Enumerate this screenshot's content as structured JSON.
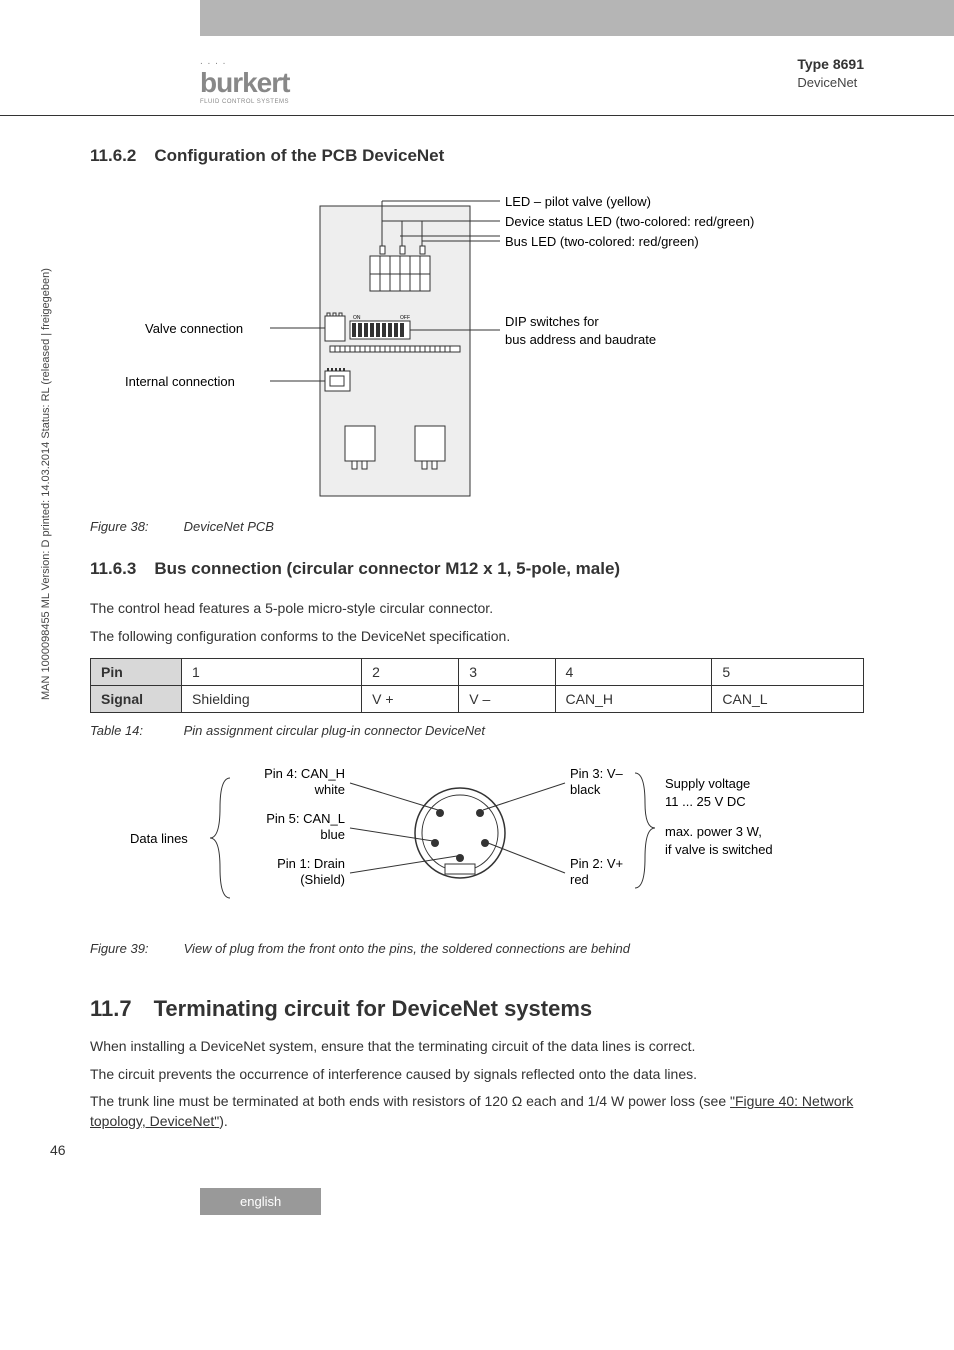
{
  "header": {
    "logo_main": "burkert",
    "logo_sub": "FLUID CONTROL SYSTEMS",
    "type_label": "Type 8691",
    "subtitle": "DeviceNet"
  },
  "side_meta": "MAN 1000098455 ML Version: D printed: 14.03.2014 Status: RL (released | freigegeben)",
  "s11_6_2": {
    "num": "11.6.2",
    "title": "Configuration of the PCB DeviceNet"
  },
  "fig38": {
    "labels": {
      "led_pilot": "LED – pilot valve (yellow)",
      "device_status": "Device status LED (two-colored: red/green)",
      "bus_led": "Bus LED (two-colored: red/green)",
      "valve_conn": "Valve connection",
      "internal_conn": "Internal connection",
      "dip_line1": "DIP switches for",
      "dip_line2": "bus address and baudrate",
      "on_label": "ON",
      "off_label": "OFF"
    },
    "caption_label": "Figure 38:",
    "caption_text": "DeviceNet PCB"
  },
  "s11_6_3": {
    "num": "11.6.3",
    "title": "Bus connection (circular connector M12 x 1, 5-pole, male)",
    "p1": "The control head features a 5-pole micro-style circular connector.",
    "p2": "The following configuration conforms to the DeviceNet specification."
  },
  "table14": {
    "row_pin_label": "Pin",
    "row_signal_label": "Signal",
    "cols": [
      "1",
      "2",
      "3",
      "4",
      "5"
    ],
    "signals": [
      "Shielding",
      "V +",
      "V –",
      "CAN_H",
      "CAN_L"
    ],
    "caption_label": "Table 14:",
    "caption_text": "Pin assignment circular plug-in connector DeviceNet"
  },
  "fig39": {
    "labels": {
      "data_lines": "Data lines",
      "pin4_l1": "Pin 4: CAN_H",
      "pin4_l2": "white",
      "pin5_l1": "Pin 5: CAN_L",
      "pin5_l2": "blue",
      "pin1_l1": "Pin 1: Drain",
      "pin1_l2": "(Shield)",
      "pin3_l1": "Pin 3: V–",
      "pin3_l2": "black",
      "pin2_l1": "Pin 2: V+",
      "pin2_l2": "red",
      "supply_l1": "Supply voltage",
      "supply_l2": "11 ... 25 V DC",
      "supply_l3": "max. power 3 W,",
      "supply_l4": "if valve is switched"
    },
    "caption_label": "Figure 39:",
    "caption_text": "View of plug from the front onto the pins, the soldered connections are behind"
  },
  "s11_7": {
    "num": "11.7",
    "title": "Terminating circuit for DeviceNet systems",
    "p1": "When installing a DeviceNet system, ensure that the terminating circuit of the data lines is correct.",
    "p2": "The circuit prevents the occurrence of interference caused by signals reflected onto the data lines.",
    "p3_a": "The trunk line must be terminated at both ends with resistors of 120 ",
    "p3_b": " each and 1/4 W power loss (see ",
    "p3_link": "\"Figure 40: Network topology, DeviceNet\"",
    "p3_c": ")."
  },
  "page_number": "46",
  "footer_lang": "english"
}
